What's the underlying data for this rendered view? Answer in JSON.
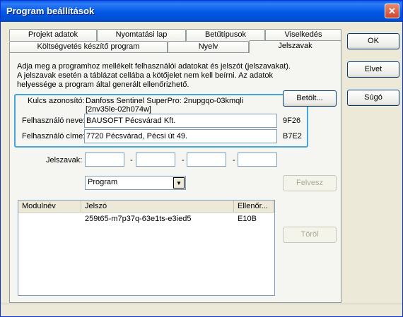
{
  "window": {
    "title": "Program beállítások"
  },
  "tabs": {
    "row1": [
      "Projekt adatok",
      "Nyomtatási lap",
      "Betűtípusok",
      "Viselkedés"
    ],
    "row2": [
      "Költségvetés készítő program",
      "Nyelv",
      "Jelszavak"
    ]
  },
  "intro": {
    "line1": "Adja meg a programhoz mellékelt felhasználói adatokat és jelszót (jelszavakat).",
    "line2": "A jelszavak esetén a táblázat cellába a kötőjelet nem kell beírni. Az adatok",
    "line3": "helyessége a program által generált ellenőrizhető."
  },
  "key": {
    "label": "Kulcs azonosító:",
    "value_line1": "Danfoss Sentinel SuperPro: 2nupgqo-03kmqli",
    "value_line2": "[2nv35le-02h074w]",
    "load_button": "Betölt..."
  },
  "user": {
    "name_label": "Felhasználó neve:",
    "name_value": "BAUSOFT Pécsvárad Kft.",
    "name_check": "9F26",
    "address_label": "Felhasználó címe:",
    "address_value": "7720 Pécsvárad, Pécsi út 49.",
    "address_check": "B7E2"
  },
  "passwords": {
    "label": "Jelszavak:",
    "parts": [
      "",
      "",
      "",
      ""
    ],
    "separator": "-",
    "add_button": "Felvesz",
    "delete_button": "Töröl"
  },
  "module_select": {
    "selected": "Program"
  },
  "table": {
    "headers": [
      "Modulnév",
      "Jelszó",
      "Ellenőr..."
    ],
    "rows": [
      {
        "module": "",
        "password": "259t65-m7p37q-63e1ts-e3ied5",
        "check": "E10B"
      }
    ]
  },
  "side_buttons": {
    "ok": "OK",
    "cancel": "Elvet",
    "help": "Súgó"
  }
}
